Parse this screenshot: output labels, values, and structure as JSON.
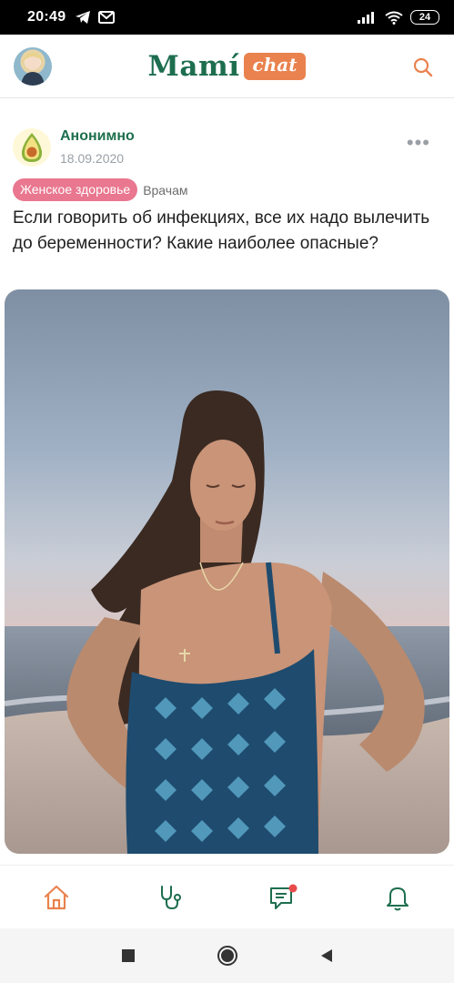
{
  "status_bar": {
    "time": "20:49",
    "battery": "24",
    "icons": [
      "telegram-icon",
      "gmail-icon",
      "signal-icon",
      "wifi-icon",
      "battery-icon"
    ]
  },
  "header": {
    "logo_main": "Mamí",
    "logo_badge": "chat",
    "icons": [
      "profile-avatar",
      "search-icon"
    ]
  },
  "post": {
    "author": "Анонимно",
    "date": "18.09.2020",
    "tags": [
      "Женское здоровье",
      "Врачам"
    ],
    "question": "Если говорить об инфекциях, все их надо вылечить до беременности? Какие наиболее опасные?",
    "avatar_icon": "avocado-icon",
    "more_icon": "more-dots-icon"
  },
  "bottom_nav": {
    "items": [
      {
        "icon": "home-icon",
        "active": true
      },
      {
        "icon": "stethoscope-icon",
        "active": false
      },
      {
        "icon": "chat-icon",
        "active": false,
        "has_badge": true
      },
      {
        "icon": "bell-icon",
        "active": false
      }
    ]
  },
  "system_nav": [
    "recents-icon",
    "home-circle-icon",
    "back-icon"
  ],
  "colors": {
    "brand_green": "#1d6e4f",
    "brand_orange": "#e9824e",
    "tag_pink": "#e9778f",
    "notification_red": "#e94b4b"
  }
}
